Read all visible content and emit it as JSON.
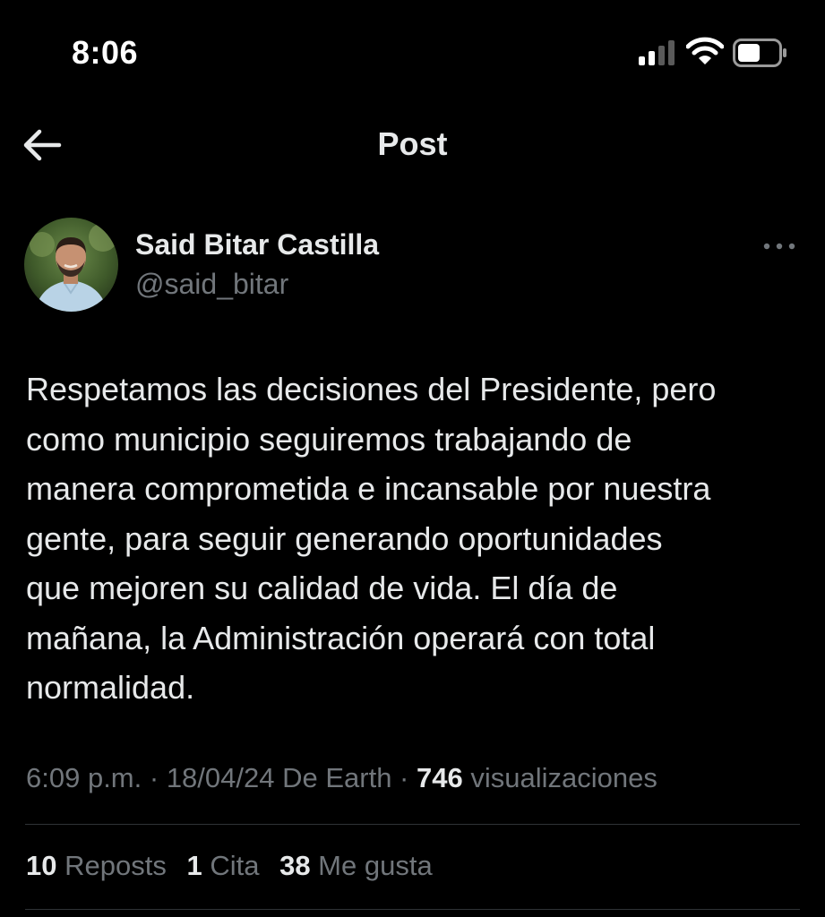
{
  "status_bar": {
    "time": "8:06"
  },
  "nav": {
    "title": "Post"
  },
  "author": {
    "display_name": "Said Bitar Castilla",
    "handle": "@said_bitar"
  },
  "post": {
    "text": "Respetamos las decisiones del Presidente, pero\ncomo municipio seguiremos trabajando de\nmanera comprometida e incansable por nuestra\ngente, para seguir generando oportunidades\nque mejoren su calidad de vida. El día de\nmañana, la Administración operará con total\nnormalidad.",
    "time": "6:09 p.m.",
    "sep1": " · ",
    "date": "18/04/24",
    "source": " De Earth",
    "sep2": " · ",
    "views_count": "746",
    "views_label": " visualizaciones"
  },
  "stats": {
    "reposts_count": "10",
    "reposts_label": " Reposts",
    "quotes_count": "1",
    "quotes_label": " Cita",
    "likes_count": "38",
    "likes_label": " Me gusta"
  },
  "colors": {
    "background": "#000000",
    "primary_text": "#e7e9ea",
    "secondary_text": "#71767b",
    "divider": "#2f3336"
  },
  "icons": [
    "signal-icon",
    "wifi-icon",
    "battery-icon",
    "back-arrow-icon",
    "more-options-icon",
    "avatar"
  ]
}
